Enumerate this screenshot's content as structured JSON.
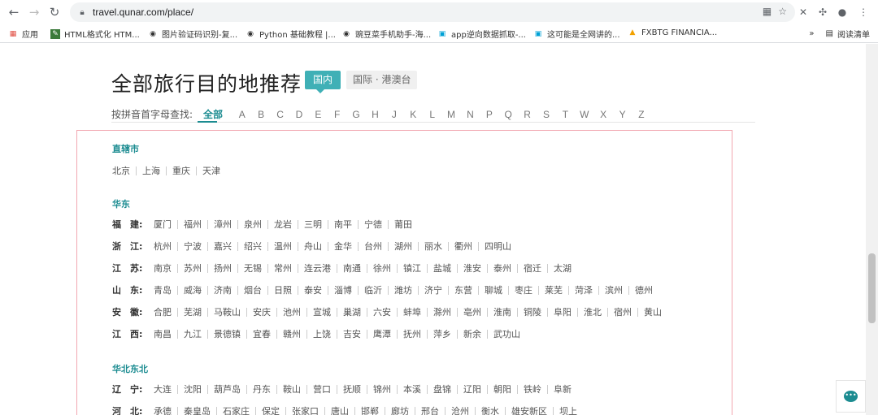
{
  "browser": {
    "url": "travel.qunar.com/place/",
    "bookmarks": [
      {
        "icon": "apps-grid-icon",
        "label": "应用"
      },
      {
        "icon": "tool-icon",
        "label": "HTML格式化 HTM..."
      },
      {
        "icon": "globe-icon",
        "label": "图片验证码识别-复..."
      },
      {
        "icon": "globe-icon",
        "label": "Python 基础教程 |..."
      },
      {
        "icon": "globe-icon",
        "label": "豌豆菜手机助手-海..."
      },
      {
        "icon": "tv-icon",
        "label": "app逆向数据抓取-..."
      },
      {
        "icon": "tv-icon",
        "label": "这可能是全网讲的..."
      },
      {
        "icon": "warning-triangle-icon",
        "label": "FXBTG FINANCIA..."
      }
    ],
    "more": "»",
    "reading_list": "阅读清单"
  },
  "page": {
    "title": "全部旅行目的地推荐",
    "tab_domestic": "国内",
    "tab_international": "国际 · 港澳台",
    "pinyin_label": "按拼音首字母查找:",
    "pinyin_all": "全部",
    "letters": [
      "A",
      "B",
      "C",
      "D",
      "E",
      "F",
      "G",
      "H",
      "J",
      "K",
      "L",
      "M",
      "N",
      "P",
      "Q",
      "R",
      "S",
      "T",
      "W",
      "X",
      "Y",
      "Z"
    ]
  },
  "regions": [
    {
      "name": "直辖市",
      "rows": [
        {
          "province": "",
          "cities": [
            "北京",
            "上海",
            "重庆",
            "天津"
          ]
        }
      ]
    },
    {
      "name": "华东",
      "rows": [
        {
          "province": "福　建:",
          "cities": [
            "厦门",
            "福州",
            "漳州",
            "泉州",
            "龙岩",
            "三明",
            "南平",
            "宁德",
            "莆田"
          ]
        },
        {
          "province": "浙　江:",
          "cities": [
            "杭州",
            "宁波",
            "嘉兴",
            "绍兴",
            "温州",
            "舟山",
            "金华",
            "台州",
            "湖州",
            "丽水",
            "衢州",
            "四明山"
          ]
        },
        {
          "province": "江　苏:",
          "cities": [
            "南京",
            "苏州",
            "扬州",
            "无锡",
            "常州",
            "连云港",
            "南通",
            "徐州",
            "镇江",
            "盐城",
            "淮安",
            "泰州",
            "宿迁",
            "太湖"
          ]
        },
        {
          "province": "山　东:",
          "cities": [
            "青岛",
            "威海",
            "济南",
            "烟台",
            "日照",
            "泰安",
            "淄博",
            "临沂",
            "潍坊",
            "济宁",
            "东营",
            "聊城",
            "枣庄",
            "莱芜",
            "菏泽",
            "滨州",
            "德州"
          ]
        },
        {
          "province": "安　徽:",
          "cities": [
            "合肥",
            "芜湖",
            "马鞍山",
            "安庆",
            "池州",
            "宣城",
            "巢湖",
            "六安",
            "蚌埠",
            "滁州",
            "亳州",
            "淮南",
            "铜陵",
            "阜阳",
            "淮北",
            "宿州",
            "黄山"
          ]
        },
        {
          "province": "江　西:",
          "cities": [
            "南昌",
            "九江",
            "景德镇",
            "宜春",
            "赣州",
            "上饶",
            "吉安",
            "鹰潭",
            "抚州",
            "萍乡",
            "新余",
            "武功山"
          ]
        }
      ]
    },
    {
      "name": "华北东北",
      "rows": [
        {
          "province": "辽　宁:",
          "cities": [
            "大连",
            "沈阳",
            "葫芦岛",
            "丹东",
            "鞍山",
            "营口",
            "抚顺",
            "锦州",
            "本溪",
            "盘锦",
            "辽阳",
            "朝阳",
            "铁岭",
            "阜新"
          ]
        },
        {
          "province": "河　北:",
          "cities": [
            "承德",
            "秦皇岛",
            "石家庄",
            "保定",
            "张家口",
            "唐山",
            "邯郸",
            "廊坊",
            "邢台",
            "沧州",
            "衡水",
            "雄安新区",
            "坝上"
          ]
        }
      ]
    }
  ]
}
